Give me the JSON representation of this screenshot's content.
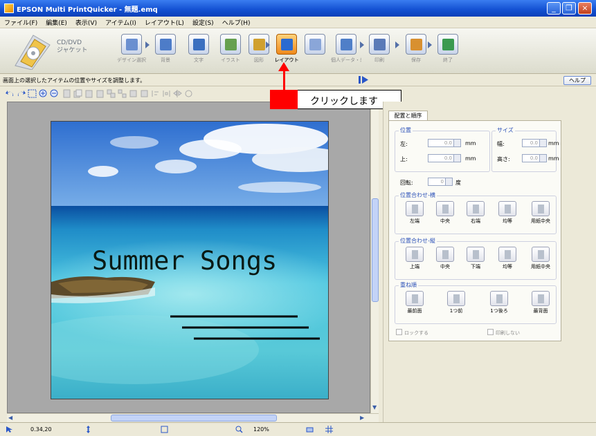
{
  "window": {
    "title": "EPSON Multi PrintQuicker - 無題.emq",
    "min_glyph": "_",
    "max_glyph": "❐",
    "close_glyph": "×"
  },
  "menu": [
    "ファイル(F)",
    "編集(E)",
    "表示(V)",
    "アイテム(I)",
    "レイアウト(L)",
    "設定(S)",
    "ヘルプ(H)"
  ],
  "mode": {
    "line1": "CD/DVD",
    "line2": "ジャケット"
  },
  "toolbar": [
    {
      "label": "デザイン選択",
      "active": false,
      "color": "#6a8fd0"
    },
    {
      "label": "背景",
      "active": false,
      "color": "#4d7cc8"
    },
    {
      "label": "文字",
      "active": false,
      "color": "#3b6fc0"
    },
    {
      "label": "イラスト",
      "active": false,
      "color": "#66a050"
    },
    {
      "label": "図形",
      "active": false,
      "color": "#d0a030"
    },
    {
      "label": "レイアウト",
      "active": true,
      "color": "#2a6ad0"
    },
    {
      "label": "",
      "active": false,
      "color": "#8aa6d8"
    },
    {
      "label": "個人データ・差込",
      "active": false,
      "color": "#4f7fc8"
    },
    {
      "label": "印刷",
      "active": false,
      "color": "#5a7ab8"
    },
    {
      "label": "保存",
      "active": false,
      "color": "#d89030"
    },
    {
      "label": "終了",
      "active": false,
      "color": "#3a9a50"
    }
  ],
  "hint": "画面上の選択したアイテムの位置やサイズを調整します。",
  "help_button": "ヘルプ",
  "callout": "クリックします",
  "jacket_title": "Summer Songs",
  "panel": {
    "tab": "配置と順序",
    "position_group": "位置",
    "x_label": "左:",
    "y_label": "上:",
    "x_value": "0.0",
    "y_value": "0.0",
    "size_group": "サイズ",
    "w_label": "幅:",
    "h_label": "高さ:",
    "w_value": "0.0",
    "h_value": "0.0",
    "unit": "mm",
    "rotate_label": "回転:",
    "rotate_value": "0",
    "rotate_unit": "度",
    "halign_group": "位置合わせ-横",
    "halign": [
      "左端",
      "中央",
      "右端",
      "均等",
      "用紙中央"
    ],
    "valign_group": "位置合わせ-縦",
    "valign": [
      "上端",
      "中央",
      "下端",
      "均等",
      "用紙中央"
    ],
    "order_group": "重ね順",
    "order": [
      "最前面",
      "1つ前",
      "1つ後ろ",
      "最背面"
    ],
    "lock_label": "ロックする",
    "noprint_label": "印刷しない"
  },
  "statusbar": {
    "pos": "0.34,20",
    "zoom": "120%"
  }
}
